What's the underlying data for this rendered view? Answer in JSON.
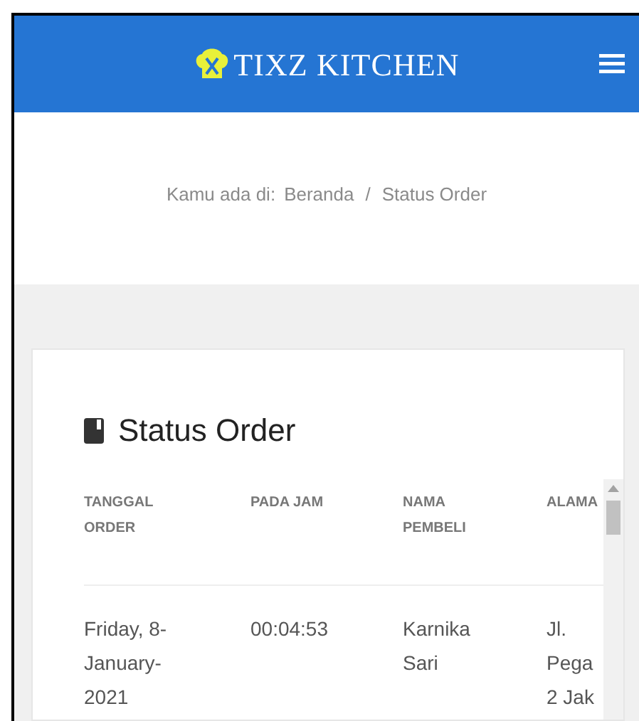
{
  "header": {
    "brand": "TIXZ KITCHEN"
  },
  "breadcrumb": {
    "prefix": "Kamu ada di:",
    "items": [
      "Beranda",
      "Status Order"
    ],
    "separator": "/"
  },
  "card": {
    "title": "Status Order",
    "table": {
      "columns": [
        "TANGGAL ORDER",
        "PADA JAM",
        "NAMA PEMBELI",
        "ALAMA"
      ],
      "rows": [
        [
          "Friday, 8-January-2021",
          "00:04:53",
          "Karnika Sari",
          "Jl. Pega 2 Jak"
        ]
      ]
    }
  }
}
